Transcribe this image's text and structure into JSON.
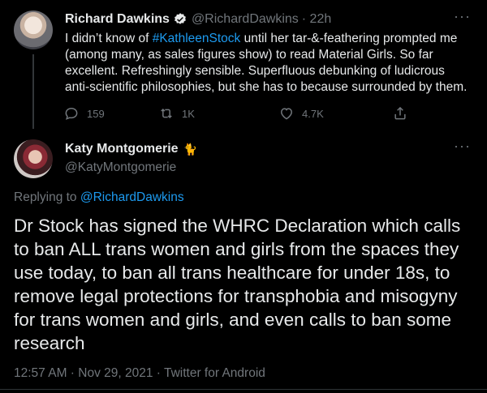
{
  "parent_tweet": {
    "name": "Richard Dawkins",
    "handle": "@RichardDawkins",
    "time": "· 22h",
    "more": "···",
    "text_before": "I didn’t know of ",
    "hashtag": "#KathleenStock",
    "text_after": " until her tar-&-feathering prompted me (among many, as sales figures show) to read Material Girls. So far excellent. Refreshingly sensible. Superfluous debunking of ludicrous anti-scientific philosophies, but she has to because surrounded by them.",
    "actions": {
      "replies": "159",
      "retweets": "1K",
      "likes": "4.7K"
    }
  },
  "main_tweet": {
    "name": "Katy Montgomerie",
    "handle": "@KatyMontgomerie",
    "more": "···",
    "replying_prefix": "Replying to ",
    "replying_mention": "@RichardDawkins",
    "text": "Dr Stock has signed the WHRC Declaration which calls to ban ALL trans women and girls from the spaces they use today, to ban all trans healthcare for under 18s, to remove legal protections for transphobia and misogyny for trans women and girls, and even calls to ban some research",
    "timestamp": "12:57 AM · Nov 29, 2021 · Twitter for Android"
  },
  "colors": {
    "background": "#000000",
    "text": "#e7e9ea",
    "secondary": "#71767b",
    "link": "#1d9bf0"
  },
  "icons": [
    "verified-badge-icon",
    "reply-icon",
    "retweet-icon",
    "like-icon",
    "share-icon",
    "more-icon",
    "cat-emoji-icon"
  ]
}
